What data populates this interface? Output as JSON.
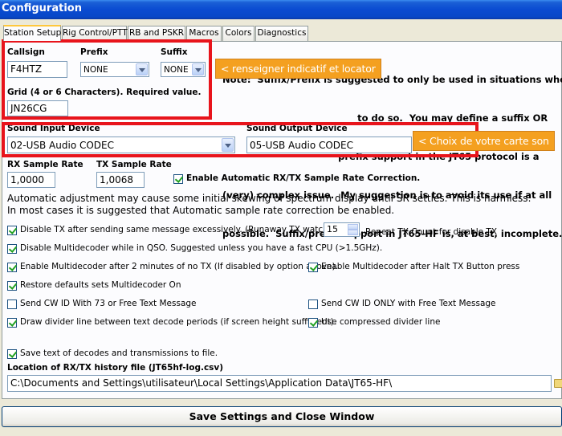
{
  "window": {
    "title": "Configuration"
  },
  "tabs": [
    {
      "label": "Station Setup"
    },
    {
      "label": "Rig Control/PTT"
    },
    {
      "label": "RB and PSKR"
    },
    {
      "label": "Macros"
    },
    {
      "label": "Colors"
    },
    {
      "label": "Diagnostics"
    }
  ],
  "station": {
    "callsign_label": "Callsign",
    "callsign_value": "F4HTZ",
    "prefix_label": "Prefix",
    "prefix_value": "NONE",
    "suffix_label": "Suffix",
    "suffix_value": "NONE",
    "grid_label": "Grid (4 or 6 Characters).  Required value.",
    "grid_value": "JN26CG"
  },
  "note_lines": [
    "Note:  Suffix/Prefix is suggested to only be used in situations where",
    "                                          to do so.  You may define a suffix OR",
    "                                    prefix support in the JT65 protocol is a",
    "(very) complex issue.  My suggestion is to avoid its use if at all",
    "possible.  Suffix/prefix support in JT65-HF is, at best, incomplete."
  ],
  "callouts": {
    "callsign": "< renseigner indicatif et locator",
    "sound": "< Choix de votre carte son"
  },
  "sound": {
    "input_label": "Sound Input Device",
    "input_value": "02-USB Audio CODEC",
    "output_label": "Sound Output Device",
    "output_value": "05-USB Audio CODEC",
    "rx_rate_label": "RX Sample Rate",
    "rx_rate_value": "1,0000",
    "tx_rate_label": "TX Sample Rate",
    "tx_rate_value": "1,0068",
    "auto_correction_label": "Enable Automatic RX/TX Sample Rate Correction.",
    "auto_note_1": "Automatic adjustment may cause some initial skewing of spectrum display until SR settles.  This is harmless.",
    "auto_note_2": "In most cases it is suggested that Automatic sample rate correction be enabled."
  },
  "options": {
    "disable_tx": "Disable TX after sending same message excessively. (Runaway TX watchdog)",
    "repeat_count_value": "15",
    "repeat_count_label": "Repeat TX Count for disable TX",
    "disable_multidecoder": "Disable Multidecoder while in QSO.  Suggested unless you have a fast CPU (>1.5GHz).",
    "enable_multidecoder_2min": "Enable Multidecoder after 2 minutes of no TX (If disabled by option above).",
    "enable_multidecoder_halt": "Enable Multidecoder after Halt TX Button press",
    "restore_defaults": "Restore defaults sets Multidecoder On",
    "send_cwid_73": "Send CW ID With 73 or Free Text Message",
    "send_cwid_free": "Send CW ID ONLY with Free Text Message",
    "draw_divider": "Draw divider line between text decode periods (if screen height sufficient).",
    "compressed_divider": "Use compressed divider line",
    "save_text": "Save text of decodes and transmissions to file.",
    "history_label": "Location of RX/TX history file (JT65hf-log.csv)",
    "history_path": "C:\\Documents and Settings\\utilisateur\\Local Settings\\Application Data\\JT65-HF\\"
  },
  "footer": {
    "save_button": "Save Settings and Close Window"
  },
  "colors": {
    "highlight_red": "#e8141c",
    "callout_orange": "#f4a020",
    "check_green": "#21a121"
  }
}
